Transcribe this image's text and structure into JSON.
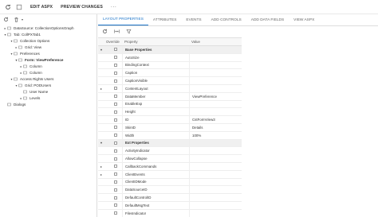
{
  "toolbar": {
    "edit_aspx": "EDIT ASPX",
    "preview_changes": "PREVIEW CHANGES",
    "more": "···"
  },
  "tree": [
    {
      "label": "DataSource: CollectionOptionsGraph",
      "expander": "▸",
      "icon": "datasource-icon",
      "bold": false
    },
    {
      "label": "Tab: CollPXTab1",
      "expander": "▾",
      "icon": "tab-icon",
      "bold": false
    },
    {
      "label": "Collection Options",
      "expander": "▾",
      "icon": "group-icon",
      "bold": false
    },
    {
      "label": "Grid: View",
      "expander": "▸",
      "icon": "grid-icon",
      "bold": false
    },
    {
      "label": "Preferences",
      "expander": "▾",
      "icon": "group-icon",
      "bold": false
    },
    {
      "label": "Form: ViewPreference",
      "expander": "▾",
      "icon": "form-icon",
      "bold": true
    },
    {
      "label": "Column",
      "expander": "▸",
      "icon": "column-icon",
      "bold": false
    },
    {
      "label": "Column",
      "expander": "▸",
      "icon": "column-icon",
      "bold": false
    },
    {
      "label": "Access Rights Users",
      "expander": "▾",
      "icon": "group-icon",
      "bold": false
    },
    {
      "label": "Grid: PODUsers",
      "expander": "▾",
      "icon": "grid-icon",
      "bold": false
    },
    {
      "label": "User Name",
      "expander": "",
      "icon": "field-icon",
      "bold": false
    },
    {
      "label": "Levels",
      "expander": "▸",
      "icon": "field-icon",
      "bold": false
    },
    {
      "label": "Dialogs",
      "expander": "",
      "icon": "dialog-icon",
      "bold": false
    }
  ],
  "tabs": [
    {
      "label": "LAYOUT PROPERTIES",
      "active": true
    },
    {
      "label": "ATTRIBUTES",
      "active": false
    },
    {
      "label": "EVENTS",
      "active": false
    },
    {
      "label": "ADD CONTROLS",
      "active": false
    },
    {
      "label": "ADD DATA FIELDS",
      "active": false
    },
    {
      "label": "VIEW ASPX",
      "active": false
    }
  ],
  "grid": {
    "headers": {
      "override": "Override",
      "property": "Property",
      "value": "Value"
    },
    "rows": [
      {
        "type": "group",
        "property": "Base Properties",
        "value": ""
      },
      {
        "type": "row",
        "property": "AutoSize",
        "value": ""
      },
      {
        "type": "row",
        "property": "BindingContext",
        "value": ""
      },
      {
        "type": "row",
        "property": "Caption",
        "value": ""
      },
      {
        "type": "row",
        "property": "CaptionVisible",
        "value": ""
      },
      {
        "type": "row",
        "property": "ContentLayout",
        "value": "",
        "arrow": true
      },
      {
        "type": "row",
        "property": "DataMember",
        "value": "ViewPreference"
      },
      {
        "type": "row",
        "property": "EnableExp",
        "value": ""
      },
      {
        "type": "row",
        "property": "Height",
        "value": ""
      },
      {
        "type": "row",
        "property": "ID",
        "value": "CstFormView3"
      },
      {
        "type": "row",
        "property": "SkinID",
        "value": "Details"
      },
      {
        "type": "row",
        "property": "Width",
        "value": "100%"
      },
      {
        "type": "group",
        "property": "Ext Properties",
        "value": ""
      },
      {
        "type": "row",
        "property": "ActivityIndicator",
        "value": ""
      },
      {
        "type": "row",
        "property": "AllowCollapse",
        "value": ""
      },
      {
        "type": "row",
        "property": "CallbackCommands",
        "value": "",
        "arrow": true
      },
      {
        "type": "row",
        "property": "ClientEvents",
        "value": "",
        "arrow": true
      },
      {
        "type": "row",
        "property": "ClientIDMode",
        "value": ""
      },
      {
        "type": "row",
        "property": "DataSourceID",
        "value": ""
      },
      {
        "type": "row",
        "property": "DefaultControlID",
        "value": ""
      },
      {
        "type": "row",
        "property": "DefaultMsgText",
        "value": ""
      },
      {
        "type": "row",
        "property": "FilesIndicator",
        "value": ""
      }
    ]
  },
  "colors": {
    "accent": "#1a73c8"
  }
}
